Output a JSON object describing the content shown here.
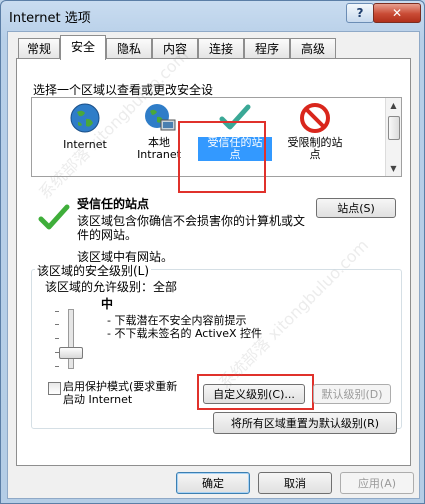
{
  "window": {
    "title": "Internet 选项",
    "help_label": "?",
    "close_label": "✕"
  },
  "tabs": [
    "常规",
    "安全",
    "隐私",
    "内容",
    "连接",
    "程序",
    "高级"
  ],
  "security": {
    "select_zone_text": "选择一个区域以查看或更改安全设",
    "zones": [
      {
        "label": "Internet",
        "icon": "globe-icon"
      },
      {
        "label": "本地\nIntranet",
        "icon": "intranet-globe-icon"
      },
      {
        "label": "受信任的站\n点",
        "icon": "checkmark-icon",
        "selected": true
      },
      {
        "label": "受限制的站\n点",
        "icon": "restricted-icon"
      }
    ],
    "zone_title": "受信任的站点",
    "sites_button": "站点(S)",
    "zone_description": "该区域包含你确信不会损害你的计算机或文\n件的网站。",
    "zone_has_sites": "该区域中有网站。",
    "security_level_group": "该区域的安全级别(L)",
    "allowed_levels": "该区域的允许级别：全部",
    "level_name": "中",
    "level_bullets": [
      "- 下载潜在不安全内容前提示",
      "- 不下载未签名的 ActiveX 控件"
    ],
    "protected_mode_label": "启用保护模式(要求重新\n启动 Internet",
    "custom_level_button": "自定义级别(C)...",
    "default_level_button": "默认级别(D)",
    "reset_all_button": "将所有区域重置为默认级别(R)"
  },
  "footer": {
    "ok": "确定",
    "cancel": "取消",
    "apply": "应用(A)"
  },
  "watermark_text": "系统部落 xitongbuluo.com"
}
